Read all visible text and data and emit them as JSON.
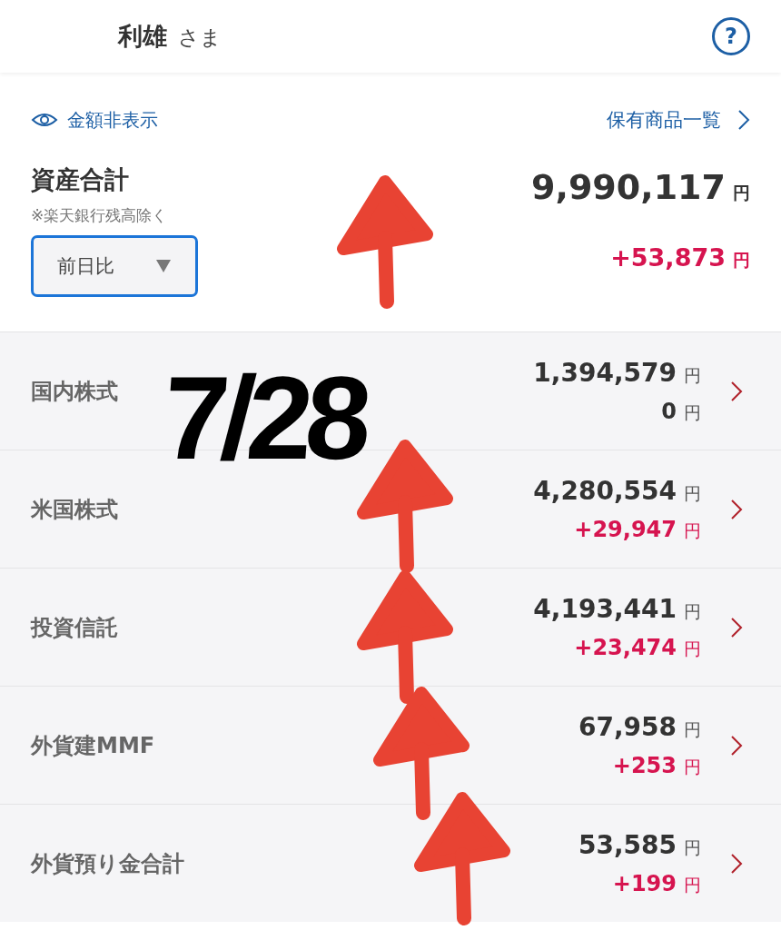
{
  "header": {
    "name": "利雄",
    "honorific": "さま",
    "help_icon": "?"
  },
  "summary": {
    "hide_amounts": "金額非表示",
    "holdings_link": "保有商品一覧",
    "title": "資産合計",
    "note": "※楽天銀行残高除く",
    "period_select": "前日比",
    "total": "9,990,117",
    "total_unit": "円",
    "change": "+53,873",
    "change_unit": "円",
    "marked": true
  },
  "rows": [
    {
      "label": "国内株式",
      "amount": "1,394,579",
      "amount_unit": "円",
      "change": "0",
      "change_unit": "円",
      "positive": false,
      "marked": false
    },
    {
      "label": "米国株式",
      "amount": "4,280,554",
      "amount_unit": "円",
      "change": "+29,947",
      "change_unit": "円",
      "positive": true,
      "marked": true
    },
    {
      "label": "投資信託",
      "amount": "4,193,441",
      "amount_unit": "円",
      "change": "+23,474",
      "change_unit": "円",
      "positive": true,
      "marked": true
    },
    {
      "label": "外貨建MMF",
      "amount": "67,958",
      "amount_unit": "円",
      "change": "+253",
      "change_unit": "円",
      "positive": true,
      "marked": true
    },
    {
      "label": "外貨預り金合計",
      "amount": "53,585",
      "amount_unit": "円",
      "change": "+199",
      "change_unit": "円",
      "positive": true,
      "marked": true
    }
  ],
  "handwriting": "7/28"
}
